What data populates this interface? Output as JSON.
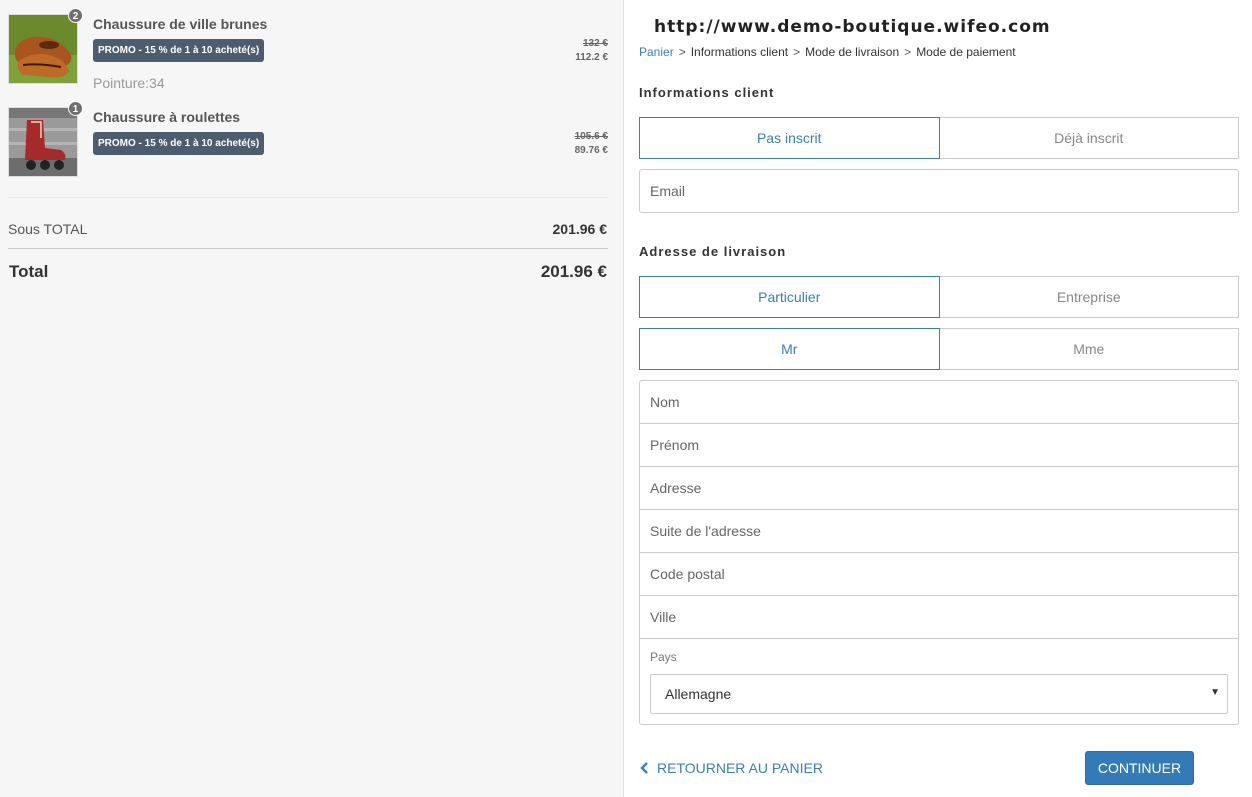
{
  "cart": {
    "items": [
      {
        "quantity": "2",
        "name": "Chaussure de ville brunes",
        "promo": "PROMO - 15 % de 1 à 10 acheté(s)",
        "size": "Pointure:34",
        "price_old": "132 €",
        "price_new": "112.2 €"
      },
      {
        "quantity": "1",
        "name": "Chaussure à roulettes",
        "promo": "PROMO - 15 % de 1 à 10 acheté(s)",
        "price_old": "105.6 €",
        "price_new": "89.76 €"
      }
    ],
    "subtotal_label": "Sous TOTAL",
    "subtotal_value": "201.96 €",
    "total_label": "Total",
    "total_value": "201.96 €"
  },
  "header": {
    "site_url": "http://www.demo-boutique.wifeo.com"
  },
  "breadcrumb": {
    "items": [
      "Panier",
      "Informations client",
      "Mode de livraison",
      "Mode de paiement"
    ],
    "separator": ">"
  },
  "client_info": {
    "title": "Informations client",
    "options": [
      "Pas inscrit",
      "Déjà inscrit"
    ],
    "selected": "Pas inscrit",
    "email_placeholder": "Email"
  },
  "delivery": {
    "title": "Adresse de livraison",
    "type_options": [
      "Particulier",
      "Entreprise"
    ],
    "type_selected": "Particulier",
    "civility_options": [
      "Mr",
      "Mme"
    ],
    "civility_selected": "Mr",
    "fields": [
      "Nom",
      "Prénom",
      "Adresse",
      "Suite de l'adresse",
      "Code postal",
      "Ville"
    ],
    "country_label": "Pays",
    "country_value": "Allemagne"
  },
  "actions": {
    "back_label": "RETOURNER AU PANIER",
    "continue_label": "CONTINUER"
  },
  "colors": {
    "accent": "#337ab7",
    "link": "#3a7ebf",
    "promo_badge": "#4d5d6f",
    "left_panel_bg": "#f6f6f6"
  },
  "icons": {
    "back": "chevron-left-icon",
    "select_arrow": "caret-down-icon"
  }
}
